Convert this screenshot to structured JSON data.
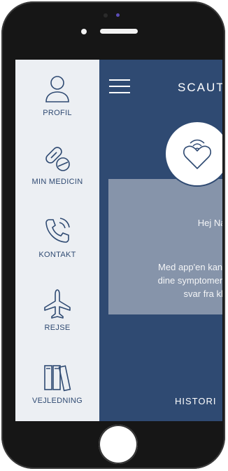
{
  "app": {
    "brand": "SCAUT",
    "menu_items": [
      {
        "label": "PROFIL",
        "icon": "person-icon"
      },
      {
        "label": "MIN MEDICIN",
        "icon": "pills-icon"
      },
      {
        "label": "KONTAKT",
        "icon": "phone-call-icon"
      },
      {
        "label": "REJSE",
        "icon": "airplane-icon"
      },
      {
        "label": "VEJLEDNING",
        "icon": "books-icon"
      }
    ],
    "card": {
      "greeting": "Hej Nav",
      "intro_line1": "Med app'en kan d",
      "intro_line2": "dine symptomer d",
      "intro_line3": "svar fra klin"
    },
    "bottom_nav": {
      "history_label": "HISTORI"
    },
    "colors": {
      "primary": "#2f4a72",
      "sidebar_bg": "#eceff3",
      "card_bg": "#8b99ae"
    }
  }
}
